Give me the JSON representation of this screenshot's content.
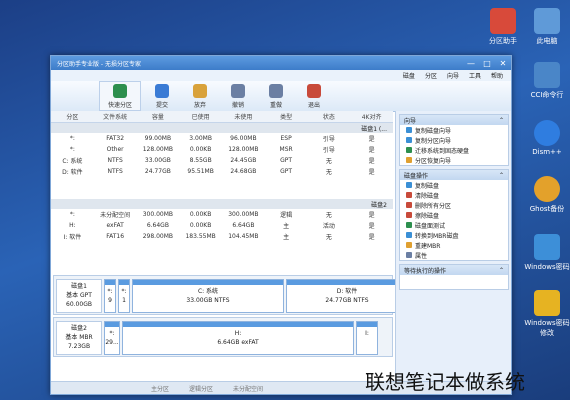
{
  "desktop": {
    "icons": [
      {
        "label": "分区助手",
        "color": "#d84a3a"
      },
      {
        "label": "此电脑",
        "color": "#5f9ad8"
      },
      {
        "label": "CCI命令行",
        "color": "#4a86c8"
      },
      {
        "label": "Dism++",
        "color": "#2f7de0"
      },
      {
        "label": "Ghost备份",
        "color": "#e3a12b"
      },
      {
        "label": "Windows密码",
        "color": "#3d8fd8"
      },
      {
        "label": "Windows密码修改",
        "color": "#e6b322"
      },
      {
        "label": "",
        "color": "#e26b2b"
      }
    ]
  },
  "window": {
    "title": "分区助手专业版 - 无损分区专家",
    "controls": [
      "—",
      "□",
      "✕"
    ]
  },
  "menu": [
    "磁盘",
    "分区",
    "向导",
    "工具",
    "帮助"
  ],
  "toolbar": {
    "items": [
      {
        "label": "快速分区",
        "color": "#2d8f4e"
      },
      {
        "label": "提交",
        "color": "#3a7bd5"
      },
      {
        "label": "放弃",
        "color": "#d9a23b"
      },
      {
        "label": "撤销",
        "color": "#6b7fa3"
      },
      {
        "label": "重做",
        "color": "#6b7fa3"
      },
      {
        "label": "退出",
        "color": "#c84a3a"
      }
    ]
  },
  "table": {
    "headers": [
      "分区",
      "文件系统",
      "容量",
      "已使用",
      "未使用",
      "类型",
      "状态",
      "4K对齐"
    ],
    "disk1": {
      "label": "磁盘1 (...",
      "rows": [
        [
          "*:",
          "FAT32",
          "99.00MB",
          "3.00MB",
          "96.00MB",
          "ESP",
          "引导",
          "是"
        ],
        [
          "*:",
          "Other",
          "128.00MB",
          "0.00KB",
          "128.00MB",
          "MSR",
          "引导",
          "是"
        ],
        [
          "C: 系统",
          "NTFS",
          "33.00GB",
          "8.55GB",
          "24.45GB",
          "GPT",
          "无",
          "是"
        ],
        [
          "D: 软件",
          "NTFS",
          "24.77GB",
          "95.51MB",
          "24.68GB",
          "GPT",
          "无",
          "是"
        ]
      ]
    },
    "disk2": {
      "label": "磁盘2",
      "rows": [
        [
          "*:",
          "未分配空间",
          "300.00MB",
          "0.00KB",
          "300.00MB",
          "逻辑",
          "无",
          "是"
        ],
        [
          "H:",
          "exFAT",
          "6.64GB",
          "0.00KB",
          "6.64GB",
          "主",
          "活动",
          "是"
        ],
        [
          "I: 软件",
          "FAT16",
          "298.00MB",
          "183.55MB",
          "104.45MB",
          "主",
          "无",
          "是"
        ]
      ]
    }
  },
  "diskmap1": {
    "left": "磁盘1\n基本 GPT\n60.00GB",
    "segs": [
      {
        "label": "*:\n9",
        "w": 10
      },
      {
        "label": "*:\n1",
        "w": 10
      },
      {
        "label": "C: 系统\n33.00GB NTFS",
        "w": 150
      },
      {
        "label": "D: 软件\n24.77GB NTFS",
        "w": 120
      }
    ]
  },
  "diskmap2": {
    "left": "磁盘2\n基本 MBR\n7.23GB",
    "segs": [
      {
        "label": "*:\n29...",
        "w": 14
      },
      {
        "label": "H:\n6.64GB exFAT",
        "w": 230
      },
      {
        "label": "I:\n",
        "w": 20
      }
    ]
  },
  "right": {
    "wizard": {
      "title": "向导",
      "items": [
        {
          "label": "复制磁盘向导",
          "color": "#3a8fd5"
        },
        {
          "label": "复制分区向导",
          "color": "#3a8fd5"
        },
        {
          "label": "迁移系统到固态硬盘",
          "color": "#2d8f4e"
        },
        {
          "label": "分区恢复向导",
          "color": "#e0a030"
        }
      ]
    },
    "ops": {
      "title": "磁盘操作",
      "items": [
        {
          "label": "复制磁盘",
          "color": "#3a8fd5"
        },
        {
          "label": "清除磁盘",
          "color": "#c84a3a"
        },
        {
          "label": "删除所有分区",
          "color": "#c84a3a"
        },
        {
          "label": "擦除磁盘",
          "color": "#c84a3a"
        },
        {
          "label": "磁盘面测试",
          "color": "#2d8f4e"
        },
        {
          "label": "转换到MBR磁盘",
          "color": "#3a8fd5"
        },
        {
          "label": "重建MBR",
          "color": "#e0a030"
        },
        {
          "label": "属性",
          "color": "#6b7fa3"
        }
      ]
    },
    "pending": {
      "title": "等待执行的操作"
    }
  },
  "status": [
    "主分区",
    "逻辑分区",
    "未分配空间"
  ],
  "watermark": "联想笔记本做系统"
}
